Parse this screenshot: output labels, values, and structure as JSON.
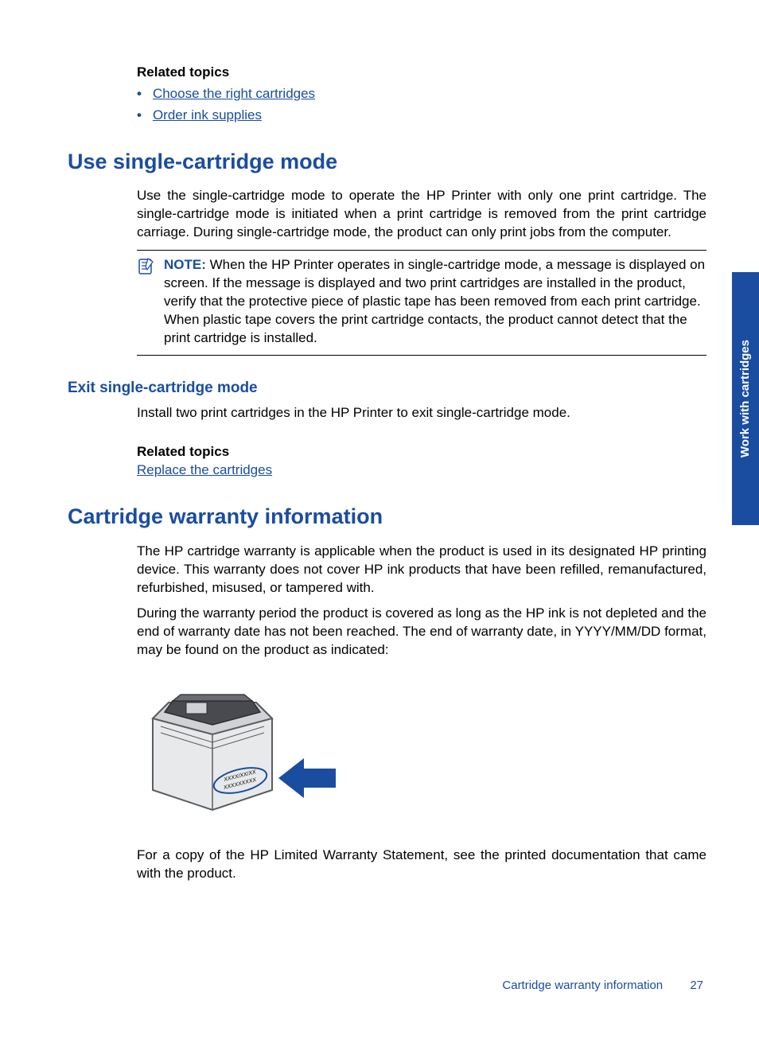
{
  "related1": {
    "heading": "Related topics",
    "links": [
      "Choose the right cartridges",
      "Order ink supplies"
    ]
  },
  "section1": {
    "title": "Use single-cartridge mode",
    "p1": "Use the single-cartridge mode to operate the HP Printer with only one print cartridge. The single-cartridge mode is initiated when a print cartridge is removed from the print cartridge carriage. During single-cartridge mode, the product can only print jobs from the computer.",
    "note_label": "NOTE:",
    "note_body": "When the HP Printer operates in single-cartridge mode, a message is displayed on screen. If the message is displayed and two print cartridges are installed in the product, verify that the protective piece of plastic tape has been removed from each print cartridge. When plastic tape covers the print cartridge contacts, the product cannot detect that the print cartridge is installed."
  },
  "section1b": {
    "title": "Exit single-cartridge mode",
    "p1": "Install two print cartridges in the HP Printer to exit single-cartridge mode.",
    "related_heading": "Related topics",
    "related_link": "Replace the cartridges"
  },
  "section2": {
    "title": "Cartridge warranty information",
    "p1": "The HP cartridge warranty is applicable when the product is used in its designated HP printing device. This warranty does not cover HP ink products that have been refilled, remanufactured, refurbished, misused, or tampered with.",
    "p2": "During the warranty period the product is covered as long as the HP ink is not depleted and the end of warranty date has not been reached. The end of warranty date, in YYYY/MM/DD format, may be found on the product as indicated:",
    "p3": "For a copy of the HP Limited Warranty Statement, see the printed documentation that came with the product."
  },
  "fig": {
    "date_label": "XXXX/XX/XX",
    "code_label": "XXXXXXXXX"
  },
  "side_tab": "Work with cartridges",
  "footer_title": "Cartridge warranty information",
  "page_number": "27"
}
